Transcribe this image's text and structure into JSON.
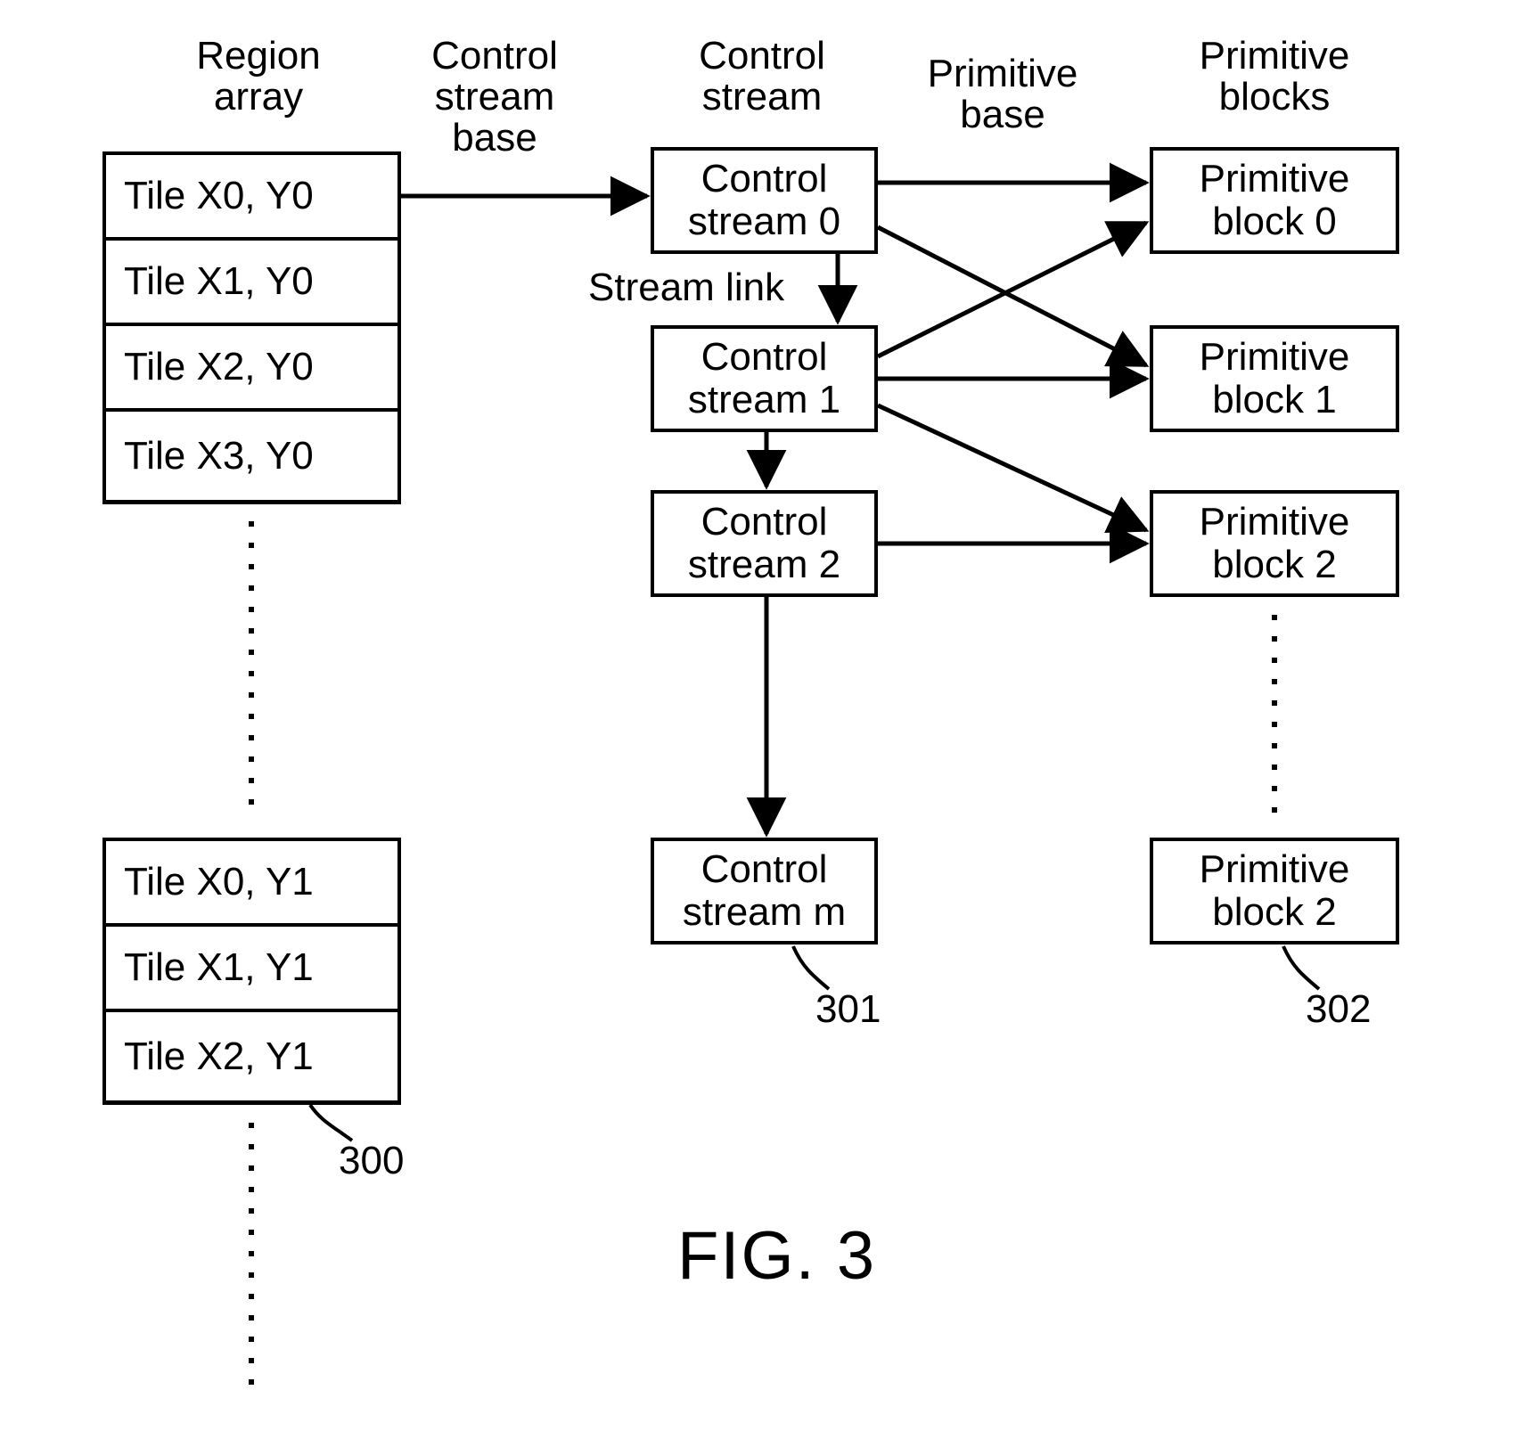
{
  "headers": {
    "region_array": "Region\narray",
    "control_stream_base": "Control\nstream\nbase",
    "control_stream": "Control\nstream",
    "primitive_base": "Primitive\nbase",
    "primitive_blocks": "Primitive\nblocks",
    "stream_link": "Stream link"
  },
  "region_array": {
    "group1": [
      "Tile X0, Y0",
      "Tile X1, Y0",
      "Tile X2, Y0",
      "Tile X3, Y0"
    ],
    "group2": [
      "Tile X0, Y1",
      "Tile X1, Y1",
      "Tile X2, Y1"
    ]
  },
  "control_streams": [
    "Control\nstream 0",
    "Control\nstream 1",
    "Control\nstream 2",
    "Control\nstream m"
  ],
  "primitive_blocks": [
    "Primitive\nblock 0",
    "Primitive\nblock 1",
    "Primitive\nblock 2",
    "Primitive\nblock 2"
  ],
  "refs": {
    "region": "300",
    "stream": "301",
    "block": "302"
  },
  "figure_label": "FIG. 3"
}
